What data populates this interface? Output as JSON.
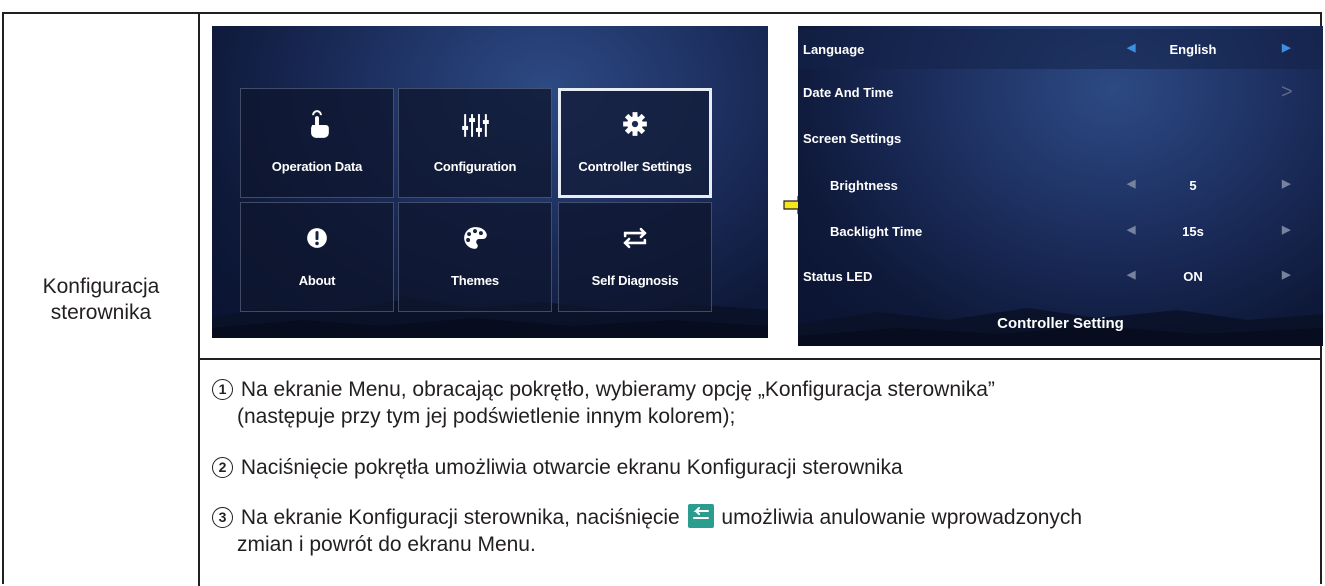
{
  "label": {
    "line1": "Konfiguracja",
    "line2": "sterownika"
  },
  "menu_screen": {
    "tiles": [
      {
        "label": "Operation Data",
        "icon": "touch-hand-icon",
        "selected": false
      },
      {
        "label": "Configuration",
        "icon": "sliders-icon",
        "selected": false
      },
      {
        "label": "Controller Settings",
        "icon": "gear-icon",
        "selected": true
      },
      {
        "label": "About",
        "icon": "exclamation-icon",
        "selected": false
      },
      {
        "label": "Themes",
        "icon": "palette-icon",
        "selected": false
      },
      {
        "label": "Self Diagnosis",
        "icon": "swap-arrows-icon",
        "selected": false
      }
    ]
  },
  "settings_screen": {
    "rows": [
      {
        "label": "Language",
        "value": "English"
      },
      {
        "label": "Date And Time",
        "value": ""
      },
      {
        "label": "Screen Settings",
        "value": ""
      },
      {
        "label": "Brightness",
        "value": "5"
      },
      {
        "label": "Backlight Time",
        "value": "15s"
      },
      {
        "label": "Status LED",
        "value": "ON"
      }
    ],
    "footer": "Controller Setting"
  },
  "steps": {
    "s1_num": "1",
    "s1_line1": "Na ekranie Menu, obracając pokrętło, wybieramy opcję „Konfiguracja sterownika”",
    "s1_line2": "(następuje przy tym jej podświetlenie innym kolorem);",
    "s2_num": "2",
    "s2_line1": "Naciśnięcie pokrętła umożliwia otwarcie ekranu Konfiguracji sterownika",
    "s3_num": "3",
    "s3_part_a": "Na ekranie Konfiguracji sterownika, naciśnięcie",
    "s3_part_b": "umożliwia anulowanie wprowadzonych",
    "s3_line2": "zmian i powrót do ekranu Menu."
  },
  "colors": {
    "accent_arrow": "#3d8fe0",
    "flow_arrow": "#f5e51c",
    "back_icon": "#2a9d8f"
  }
}
